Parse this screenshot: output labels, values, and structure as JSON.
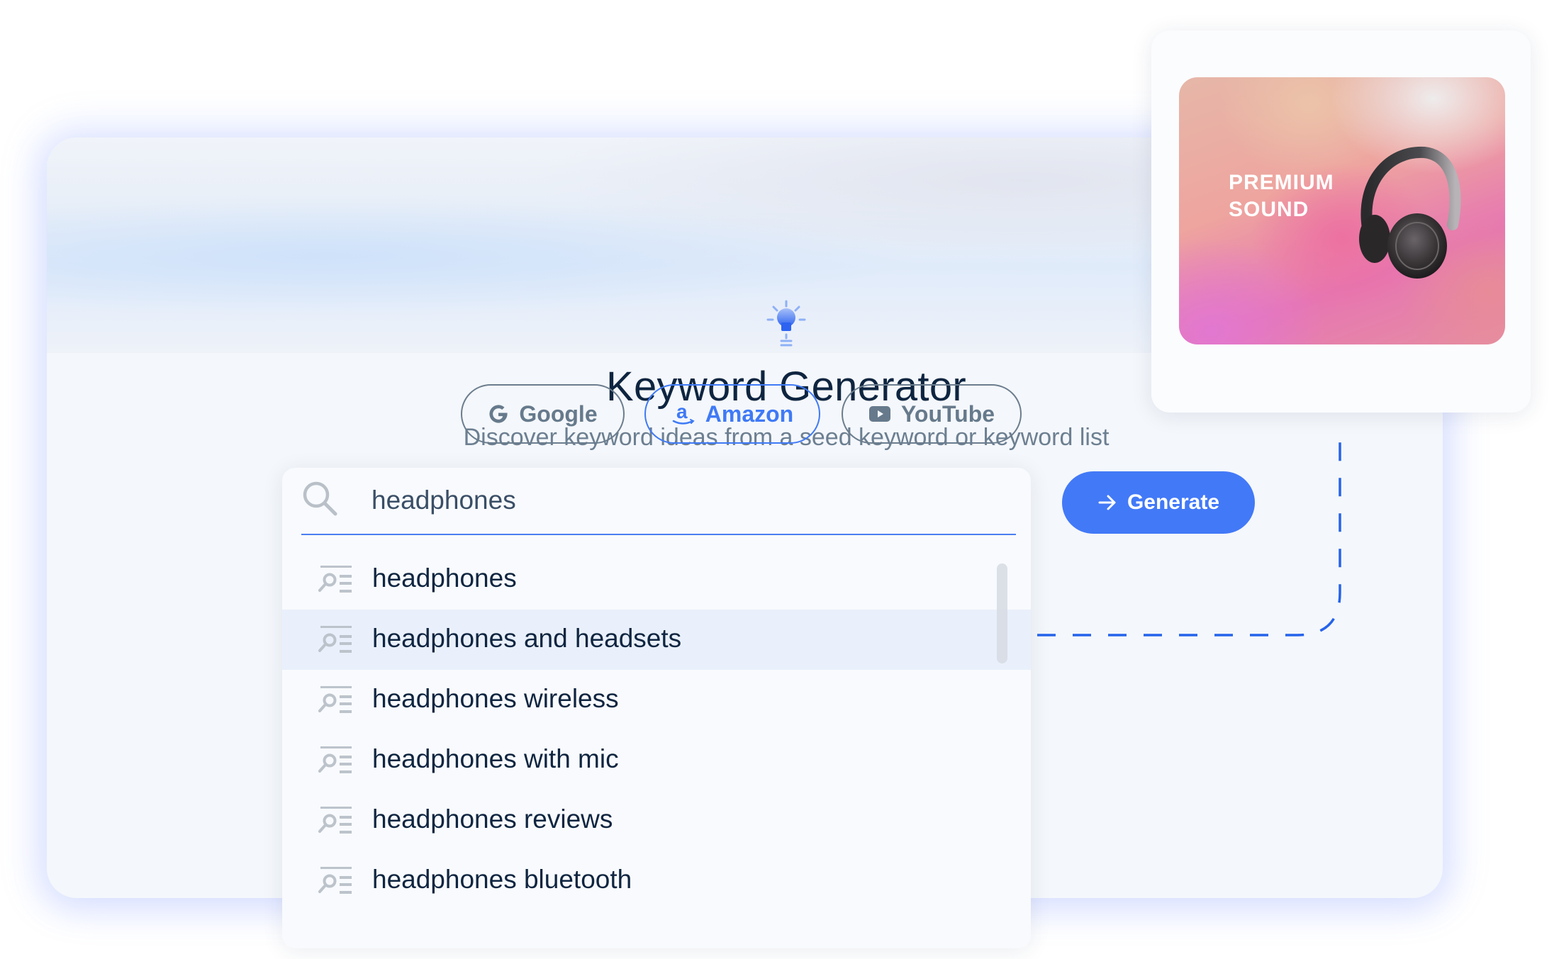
{
  "header": {
    "icon": "lightbulb-icon",
    "title": "Keyword Generator",
    "subtitle": "Discover keyword ideas from a seed keyword or keyword list"
  },
  "sources": {
    "selected": "Amazon",
    "tabs": [
      {
        "label": "Google",
        "icon": "google-g-icon",
        "active": false
      },
      {
        "label": "Amazon",
        "icon": "amazon-a-icon",
        "active": true
      },
      {
        "label": "YouTube",
        "icon": "youtube-play-icon",
        "active": false
      }
    ]
  },
  "search": {
    "icon": "search-icon",
    "value": "headphones",
    "placeholder": ""
  },
  "suggestions": {
    "item_icon": "keyword-search-list-icon",
    "highlighted_index": 1,
    "items": [
      "headphones",
      "headphones and headsets",
      "headphones wireless",
      "headphones with mic",
      "headphones reviews",
      "headphones bluetooth"
    ]
  },
  "generate_button": {
    "icon": "arrow-right-icon",
    "label": "Generate"
  },
  "promo": {
    "line1": "PREMIUM",
    "line2": "SOUND",
    "image": "headphones-image"
  },
  "colors": {
    "accent": "#4279f7",
    "title": "#0e2540",
    "muted": "#6c7f91",
    "connector": "#2563eb"
  }
}
